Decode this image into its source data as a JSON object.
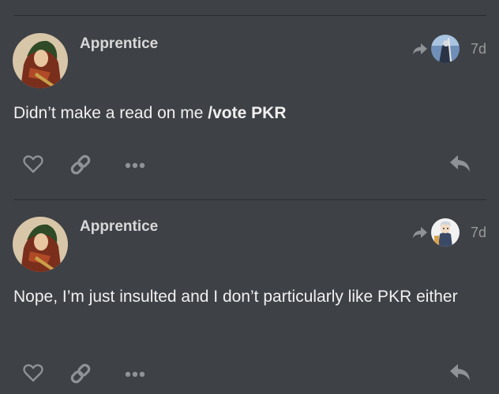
{
  "posts": [
    {
      "username": "Apprentice",
      "age": "7d",
      "body_text": "Didn’t make a read on me ",
      "body_bold": "/vote PKR"
    },
    {
      "username": "Apprentice",
      "age": "7d",
      "body_text": "Nope, I’m just insulted and I don’t particularly like PKR either",
      "body_bold": ""
    }
  ],
  "icons": {
    "like": "heart-icon",
    "link": "link-icon",
    "more": "ellipsis-icon",
    "reply": "reply-icon",
    "reply_to": "reply-to-arrow-icon"
  },
  "colors": {
    "background": "#3e4146",
    "icon": "#8f9296",
    "text": "#f0f0f0",
    "muted": "#9a9a9a"
  }
}
